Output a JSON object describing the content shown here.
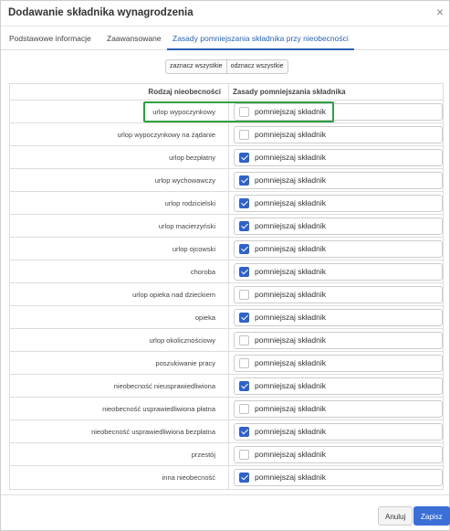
{
  "dialog": {
    "title": "Dodawanie składnika wynagrodzenia",
    "close_glyph": "×"
  },
  "tabs": [
    {
      "label": "Podstawowe informacje",
      "active": false
    },
    {
      "label": "Zaawansowane",
      "active": false
    },
    {
      "label": "Zasady pomniejszania składnika przy nieobecności",
      "active": true
    }
  ],
  "toolbar": {
    "select_all": "zaznacz wszystkie",
    "deselect_all": "odznacz wszystkie"
  },
  "table": {
    "headers": [
      "Rodzaj nieobecności",
      "Zasady pomniejszania składnika"
    ],
    "checkbox_label": "pomniejszaj składnik",
    "rows": [
      {
        "label": "urlop wypoczynkowy",
        "checked": false
      },
      {
        "label": "urlop wypoczynkowy na żądanie",
        "checked": false
      },
      {
        "label": "urlop bezpłatny",
        "checked": true
      },
      {
        "label": "urlop wychowawczy",
        "checked": true
      },
      {
        "label": "urlop rodzicielski",
        "checked": true
      },
      {
        "label": "urlop macierzyński",
        "checked": true
      },
      {
        "label": "urlop ojcowski",
        "checked": true
      },
      {
        "label": "choroba",
        "checked": true
      },
      {
        "label": "urlop opieka nad dzieckiem",
        "checked": false
      },
      {
        "label": "opieka",
        "checked": true
      },
      {
        "label": "urlop okolicznościowy",
        "checked": false
      },
      {
        "label": "poszukiwanie pracy",
        "checked": false
      },
      {
        "label": "nieobecność nieusprawiedliwiona",
        "checked": true
      },
      {
        "label": "nieobecność usprawiedliwiona płatna",
        "checked": false
      },
      {
        "label": "nieobecność usprawiedliwiona bezpłatna",
        "checked": true
      },
      {
        "label": "przestój",
        "checked": false
      },
      {
        "label": "inna nieobecność",
        "checked": true
      }
    ]
  },
  "footer": {
    "cancel_label": "Anuluj",
    "save_label": "Zapisz"
  },
  "colors": {
    "accent": "#2f62c8",
    "highlight": "#2ea043"
  }
}
